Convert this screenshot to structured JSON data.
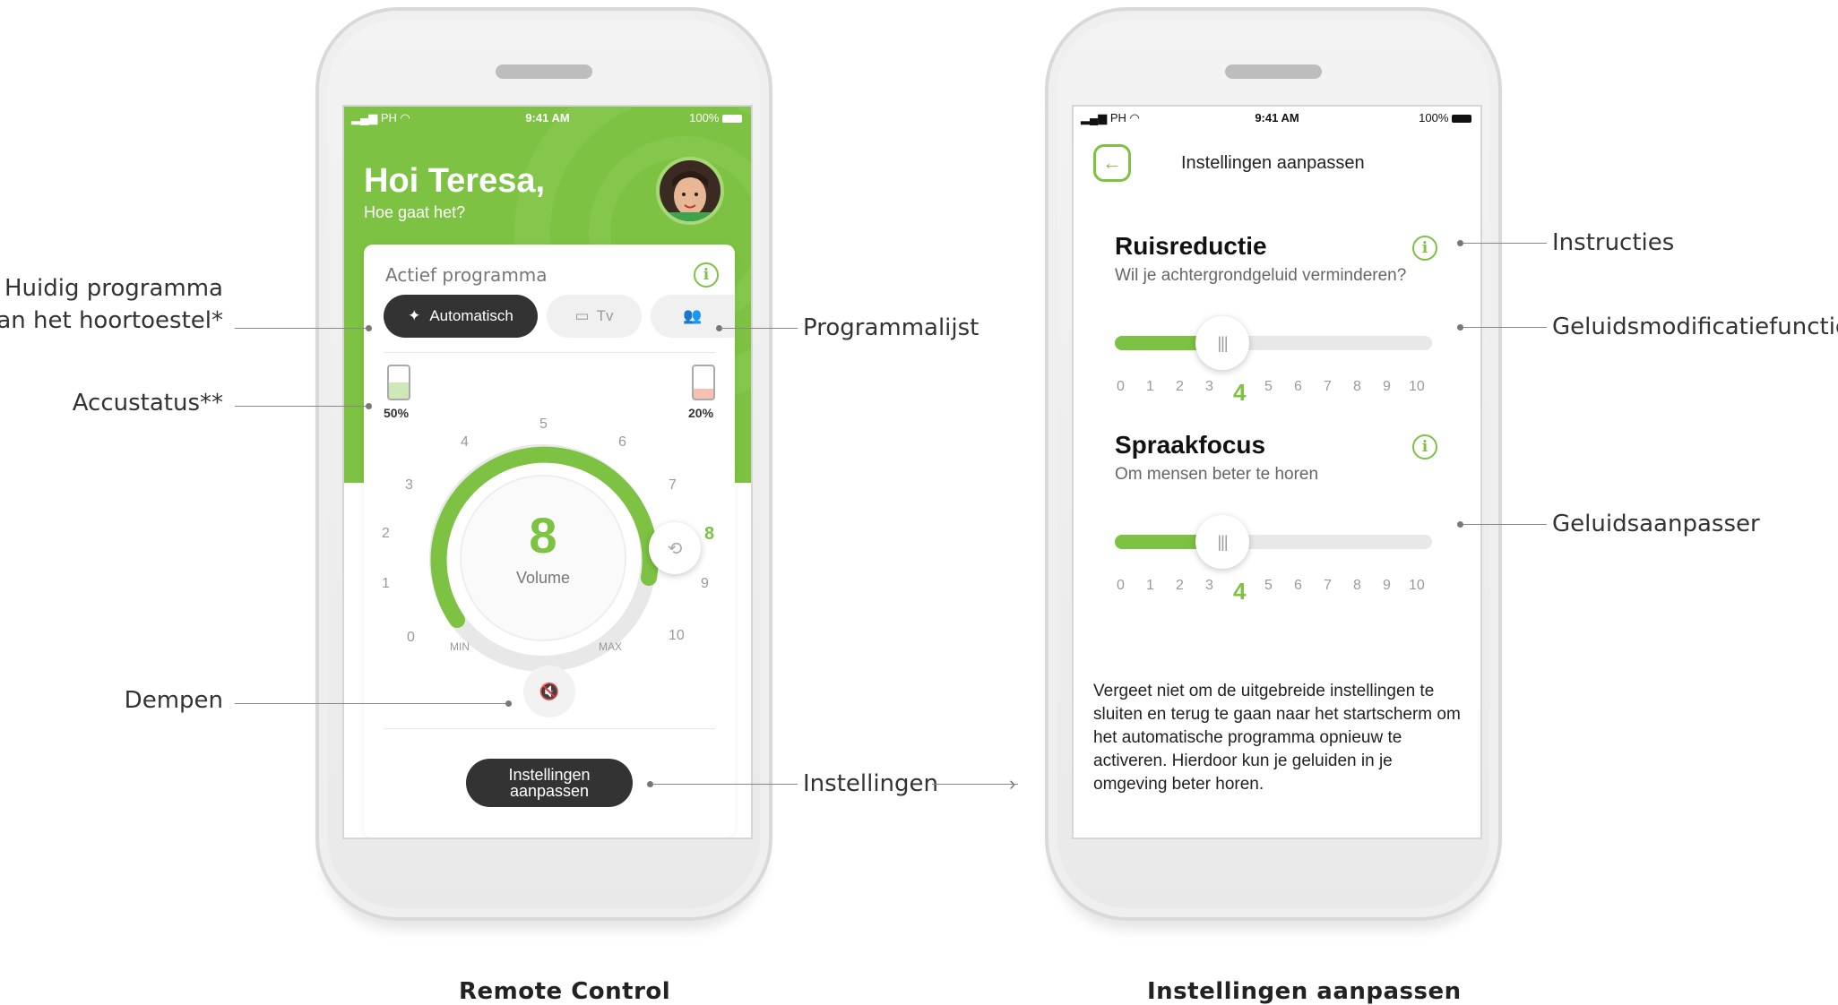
{
  "left_phone": {
    "status": {
      "carrier": "PH",
      "time": "9:41 AM",
      "battery": "100%"
    },
    "greeting": "Hoi Teresa,",
    "subgreeting": "Hoe gaat het?",
    "card_title": "Actief programma",
    "programs": [
      {
        "label": "Automatisch",
        "active": true
      },
      {
        "label": "Tv",
        "active": false
      },
      {
        "label": "",
        "active": false
      }
    ],
    "battery_left": "50%",
    "battery_right": "20%",
    "dial_numbers": [
      "0",
      "1",
      "2",
      "3",
      "4",
      "5",
      "6",
      "7",
      "8",
      "9",
      "10"
    ],
    "dial_min": "MIN",
    "dial_max": "MAX",
    "volume_value": "8",
    "volume_label": "Volume",
    "settings_button_line1": "Instellingen",
    "settings_button_line2": "aanpassen"
  },
  "right_phone": {
    "status": {
      "carrier": "PH",
      "time": "9:41 AM",
      "battery": "100%"
    },
    "header_title": "Instellingen aanpassen",
    "sections": [
      {
        "title": "Ruisreductie",
        "subtitle": "Wil je achtergrondgeluid verminderen?",
        "value": "4"
      },
      {
        "title": "Spraakfocus",
        "subtitle": "Om mensen beter te horen",
        "value": "4"
      }
    ],
    "scale": [
      "0",
      "1",
      "2",
      "3",
      "4",
      "5",
      "6",
      "7",
      "8",
      "9",
      "10"
    ],
    "footer_text": "Vergeet niet om de uitgebreide instellingen te sluiten en terug te gaan naar het startscherm om het automatische programma opnieuw te activeren. Hierdoor kun je geluiden in je omgeving beter horen."
  },
  "annotations": {
    "current_program_line1": "Huidig programma",
    "current_program_line2": "van het hoortoestel*",
    "battery_status": "Accustatus**",
    "mute": "Dempen",
    "program_list": "Programmalijst",
    "settings": "Instellingen",
    "instructions": "Instructies",
    "sound_modification": "Geluidsmodificatiefuncties",
    "sound_adjuster": "Geluidsaanpasser"
  },
  "captions": {
    "left": "Remote Control",
    "right": "Instellingen aanpassen"
  },
  "colors": {
    "accent": "#7dc242",
    "dark_pill": "#333333"
  }
}
